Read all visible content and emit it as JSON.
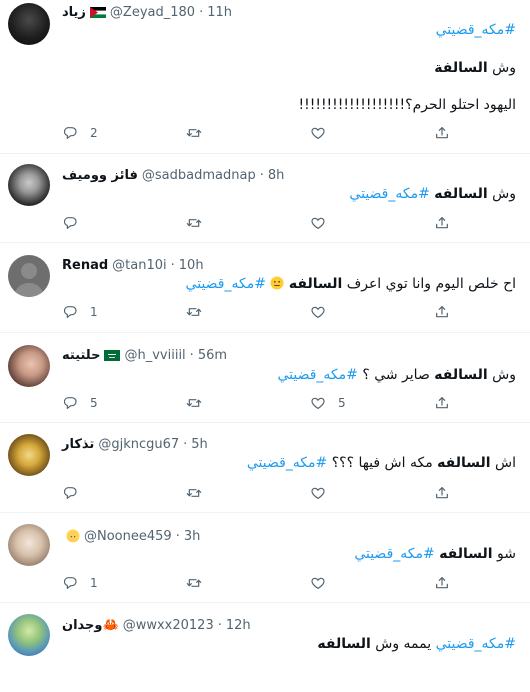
{
  "tweets": [
    {
      "display_name": "زياد",
      "handle": "@Zeyad_180",
      "time": "11h",
      "flag": "jordan-flag",
      "hashtag": "#مكه_قضيتي",
      "question": "وش",
      "question_bold": "السالفة",
      "body_line": "اليهود احتلو الحرم؟!!!!!!!!!!!!!!!!!!!",
      "reply_count": "2",
      "like_count": ""
    },
    {
      "display_name": "فائز ووميف",
      "handle": "@sadbadmadnap",
      "time": "8h",
      "text_prefix": "وش",
      "text_bold": "السالفه",
      "hashtag": "#مكه_قضيتي",
      "reply_count": "",
      "like_count": ""
    },
    {
      "display_name": "Renad",
      "handle": "@tan10i",
      "time": "10h",
      "text_prefix": "اح خلص اليوم وانا توي اعرف",
      "text_bold": "السالفه",
      "emoji": "neutral-face-emoji",
      "hashtag": "#مكه_قضيتي",
      "reply_count": "1",
      "like_count": ""
    },
    {
      "display_name": "حلتيته",
      "handle": "@h_vviiiil",
      "time": "56m",
      "flag": "saudi-flag",
      "text_prefix": "وش",
      "text_bold": "السالفه",
      "text_suffix": "صاير شي ؟",
      "hashtag": "#مكه_قضيتي",
      "reply_count": "5",
      "like_count": "5"
    },
    {
      "display_name": "تذكار",
      "handle": "@gjkncgu67",
      "time": "5h",
      "text_prefix": "اش",
      "text_bold": "السالفه",
      "text_suffix": "مكه اش فيها ؟؟؟",
      "hashtag": "#مكه_قضيتي",
      "reply_count": "",
      "like_count": ""
    },
    {
      "display_name": "",
      "handle": "@Noonee459",
      "time": "3h",
      "emoji": "blonde-person-emoji",
      "text_prefix": "شو",
      "text_bold": "السالفه",
      "hashtag": "#مكه_قضيتي",
      "reply_count": "1",
      "like_count": ""
    },
    {
      "display_name": "وجدان🦀",
      "handle": "@wwxx20123",
      "time": "12h",
      "hashtag": "#مكه_قضيتي",
      "text_middle": "يممه وش",
      "text_bold": "السالفه"
    }
  ],
  "icons": {
    "reply": "reply-icon",
    "retweet": "retweet-icon",
    "like": "heart-icon",
    "share": "share-icon"
  },
  "colors": {
    "hashtag": "#1d9bf0",
    "secondary_text": "#536471",
    "divider": "#eff3f4"
  }
}
